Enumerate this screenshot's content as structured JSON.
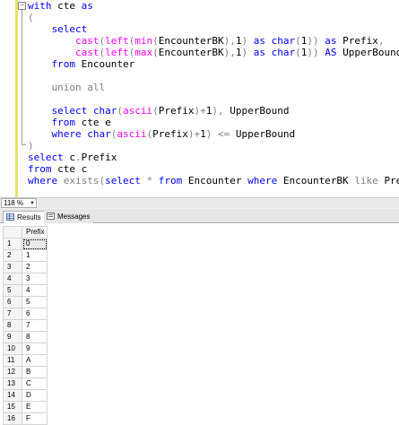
{
  "editor": {
    "lines": [
      [
        [
          "kw",
          "with "
        ],
        [
          "id",
          "cte "
        ],
        [
          "kw",
          "as"
        ]
      ],
      [
        [
          "op",
          "("
        ]
      ],
      [
        [
          "op",
          "    "
        ],
        [
          "kw",
          "select"
        ]
      ],
      [
        [
          "op",
          "        "
        ],
        [
          "fn",
          "cast"
        ],
        [
          "op",
          "("
        ],
        [
          "fn",
          "left"
        ],
        [
          "op",
          "("
        ],
        [
          "fn",
          "min"
        ],
        [
          "op",
          "("
        ],
        [
          "id",
          "EncounterBK"
        ],
        [
          "op",
          "),"
        ],
        [
          "id",
          "1"
        ],
        [
          "op",
          ") "
        ],
        [
          "kw",
          "as "
        ],
        [
          "kw",
          "char"
        ],
        [
          "op",
          "("
        ],
        [
          "id",
          "1"
        ],
        [
          "op",
          ")) "
        ],
        [
          "kw",
          "as "
        ],
        [
          "id",
          "Prefix"
        ],
        [
          "op",
          ","
        ]
      ],
      [
        [
          "op",
          "        "
        ],
        [
          "fn",
          "cast"
        ],
        [
          "op",
          "("
        ],
        [
          "fn",
          "left"
        ],
        [
          "op",
          "("
        ],
        [
          "fn",
          "max"
        ],
        [
          "op",
          "("
        ],
        [
          "id",
          "EncounterBK"
        ],
        [
          "op",
          "),"
        ],
        [
          "id",
          "1"
        ],
        [
          "op",
          ") "
        ],
        [
          "kw",
          "as "
        ],
        [
          "kw",
          "char"
        ],
        [
          "op",
          "("
        ],
        [
          "id",
          "1"
        ],
        [
          "op",
          ")) "
        ],
        [
          "kw",
          "AS "
        ],
        [
          "id",
          "UpperBound"
        ]
      ],
      [
        [
          "op",
          "    "
        ],
        [
          "kw",
          "from "
        ],
        [
          "id",
          "Encounter"
        ]
      ],
      [],
      [
        [
          "op",
          "    "
        ],
        [
          "op",
          "union all"
        ]
      ],
      [],
      [
        [
          "op",
          "    "
        ],
        [
          "kw",
          "select "
        ],
        [
          "kw",
          "char"
        ],
        [
          "op",
          "("
        ],
        [
          "fn",
          "ascii"
        ],
        [
          "op",
          "("
        ],
        [
          "id",
          "Prefix"
        ],
        [
          "op",
          ")+"
        ],
        [
          "id",
          "1"
        ],
        [
          "op",
          "), "
        ],
        [
          "id",
          "UpperBound"
        ]
      ],
      [
        [
          "op",
          "    "
        ],
        [
          "kw",
          "from "
        ],
        [
          "id",
          "cte e"
        ]
      ],
      [
        [
          "op",
          "    "
        ],
        [
          "kw",
          "where "
        ],
        [
          "kw",
          "char"
        ],
        [
          "op",
          "("
        ],
        [
          "fn",
          "ascii"
        ],
        [
          "op",
          "("
        ],
        [
          "id",
          "Prefix"
        ],
        [
          "op",
          ")+"
        ],
        [
          "id",
          "1"
        ],
        [
          "op",
          ") <= "
        ],
        [
          "id",
          "UpperBound"
        ]
      ],
      [
        [
          "op",
          ")"
        ]
      ],
      [
        [
          "kw",
          "select "
        ],
        [
          "id",
          "c"
        ],
        [
          "op",
          "."
        ],
        [
          "id",
          "Prefix"
        ]
      ],
      [
        [
          "kw",
          "from "
        ],
        [
          "id",
          "cte c"
        ]
      ],
      [
        [
          "kw",
          "where "
        ],
        [
          "op",
          "exists("
        ],
        [
          "kw",
          "select "
        ],
        [
          "op",
          "* "
        ],
        [
          "kw",
          "from "
        ],
        [
          "id",
          "Encounter "
        ],
        [
          "kw",
          "where "
        ],
        [
          "id",
          "EncounterBK "
        ],
        [
          "op",
          "like "
        ],
        [
          "id",
          "Prefix "
        ],
        [
          "op",
          "+ "
        ],
        [
          "str",
          "'%'"
        ],
        [
          "op",
          ")"
        ]
      ]
    ]
  },
  "zoom": {
    "value": "118 %"
  },
  "tabs": {
    "results_label": "Results",
    "messages_label": "Messages"
  },
  "grid": {
    "column_header": "Prefix",
    "rows": [
      {
        "n": "1",
        "v": "0"
      },
      {
        "n": "2",
        "v": "1"
      },
      {
        "n": "3",
        "v": "2"
      },
      {
        "n": "4",
        "v": "3"
      },
      {
        "n": "5",
        "v": "4"
      },
      {
        "n": "6",
        "v": "5"
      },
      {
        "n": "7",
        "v": "6"
      },
      {
        "n": "8",
        "v": "7"
      },
      {
        "n": "9",
        "v": "8"
      },
      {
        "n": "10",
        "v": "9"
      },
      {
        "n": "11",
        "v": "A"
      },
      {
        "n": "12",
        "v": "B"
      },
      {
        "n": "13",
        "v": "C"
      },
      {
        "n": "14",
        "v": "D"
      },
      {
        "n": "15",
        "v": "E"
      },
      {
        "n": "16",
        "v": "F"
      }
    ]
  },
  "colors": {
    "keyword": "#0000ff",
    "function": "#ff00ff",
    "operator": "#808080",
    "string": "#ff0000",
    "change_marker": "#e9e267"
  }
}
